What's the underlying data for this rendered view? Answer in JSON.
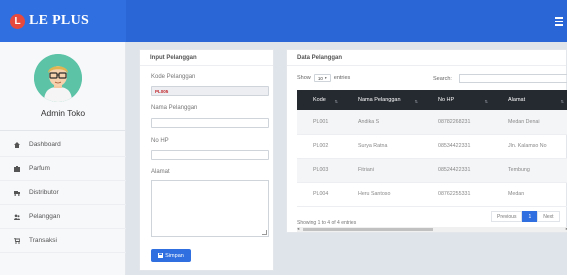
{
  "brand": {
    "logo_letter": "L",
    "name": "LE PLUS"
  },
  "user": {
    "name": "Admin Toko"
  },
  "sidebar": {
    "items": [
      {
        "label": "Dashboard",
        "icon": "home-icon"
      },
      {
        "label": "Parfum",
        "icon": "bottle-icon"
      },
      {
        "label": "Distributor",
        "icon": "truck-icon"
      },
      {
        "label": "Pelanggan",
        "icon": "users-icon"
      },
      {
        "label": "Transaksi",
        "icon": "cart-icon"
      }
    ]
  },
  "input_panel": {
    "title": "Input Pelanggan",
    "code_label": "Kode Pelanggan",
    "code_value": "PL005",
    "name_label": "Nama Pelanggan",
    "phone_label": "No HP",
    "address_label": "Alamat",
    "save_label": "Simpan"
  },
  "data_panel": {
    "title": "Data Pelanggan",
    "show_label": "Show",
    "entries_select": "10",
    "entries_label": "entries",
    "search_label": "Search:",
    "columns": [
      "Kode",
      "Nama Pelanggan",
      "No HP",
      "Alamat"
    ],
    "rows": [
      [
        "PL001",
        "Andika S",
        "08782268231",
        "Medan Denai"
      ],
      [
        "PL002",
        "Surya Ratna",
        "08534422331",
        "Jln. Kalamso No"
      ],
      [
        "PL003",
        "Fitriani",
        "08524422331",
        "Tembung"
      ],
      [
        "PL004",
        "Heru Santoso",
        "08762255331",
        "Medan"
      ]
    ],
    "info": "Showing 1 to 4 of 4 entries",
    "pagination": {
      "previous": "Previous",
      "current": "1",
      "next": "Next"
    }
  },
  "colors": {
    "primary": "#2f6fe0",
    "header_dark": "#252a30",
    "code_red": "#c1272d",
    "logo_red": "#e64a3f"
  }
}
